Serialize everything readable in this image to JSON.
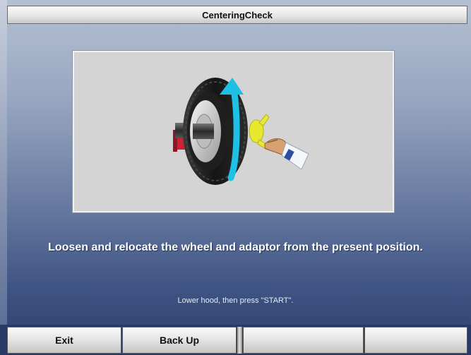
{
  "window": {
    "title": "CenteringCheck"
  },
  "main": {
    "instruction": "Loosen and relocate the wheel and adaptor from the present position.",
    "hint": "Lower hood, then press \"START\"."
  },
  "footer": {
    "buttons": [
      {
        "label": "Exit"
      },
      {
        "label": "Back Up"
      },
      {
        "label": ""
      },
      {
        "label": ""
      }
    ]
  },
  "colors": {
    "rotation_arrow": "#1ec0e6",
    "adaptor": "#e8e830",
    "flange": "#cc2233"
  }
}
